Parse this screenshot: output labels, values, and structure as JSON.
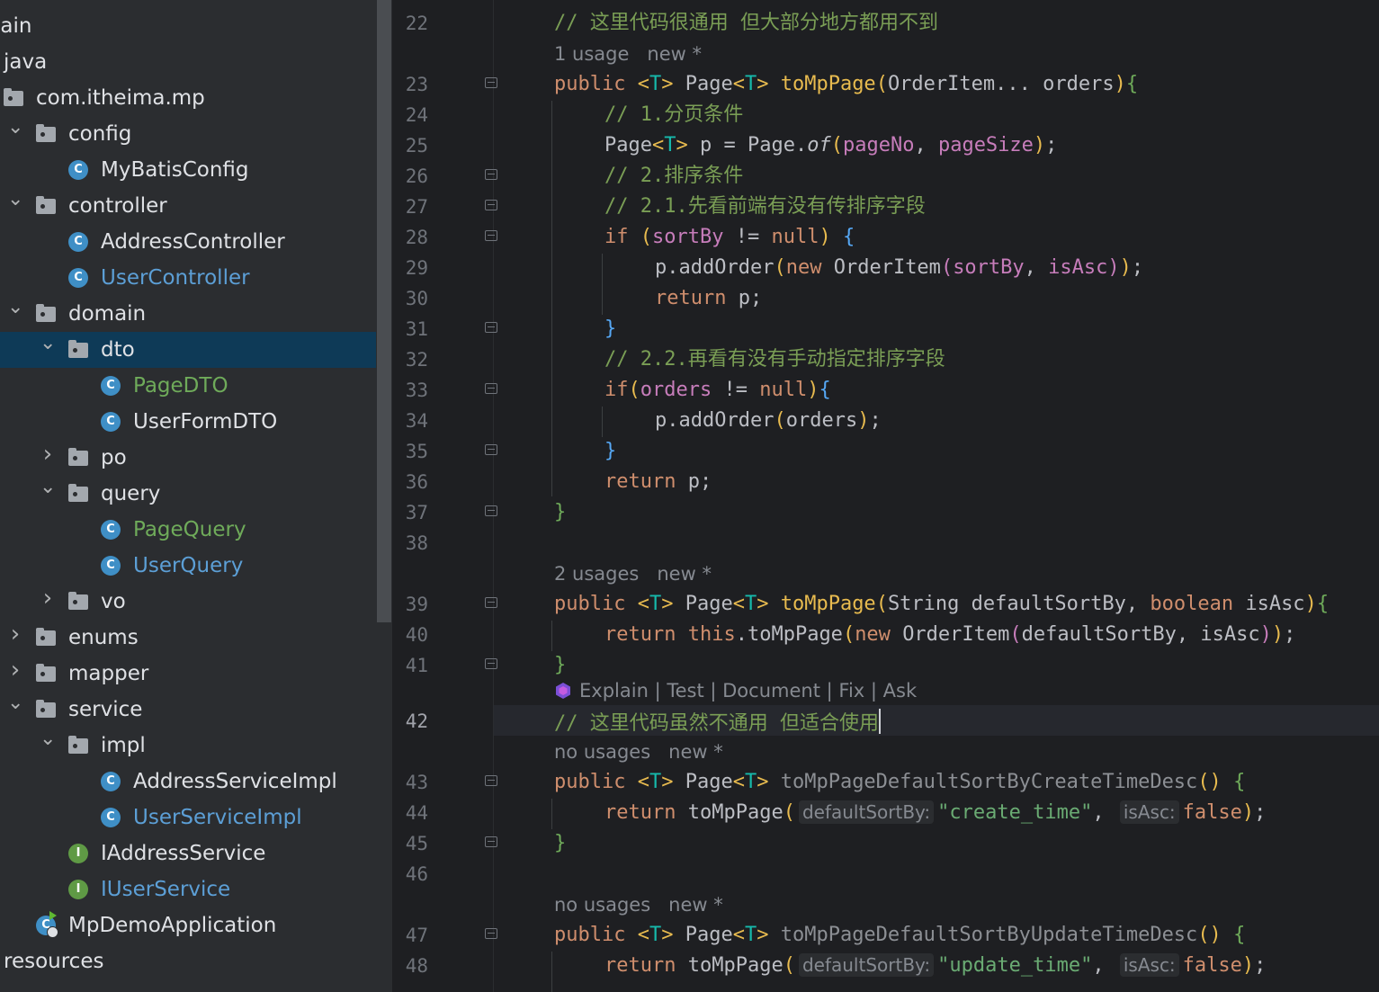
{
  "project_tree": {
    "items": [
      {
        "label": "main",
        "indent": 0,
        "chevron": "",
        "icon": "none",
        "state": "normal"
      },
      {
        "label": "java",
        "indent": 0,
        "chevron": "",
        "icon": "none",
        "state": "normal"
      },
      {
        "label": "com.itheima.mp",
        "indent": 0,
        "chevron": "",
        "icon": "package",
        "state": "normal"
      },
      {
        "label": "config",
        "indent": 1,
        "chevron": "expanded",
        "icon": "folder",
        "state": "normal"
      },
      {
        "label": "MyBatisConfig",
        "indent": 2,
        "chevron": "",
        "icon": "class",
        "state": "normal"
      },
      {
        "label": "controller",
        "indent": 1,
        "chevron": "expanded",
        "icon": "folder",
        "state": "normal"
      },
      {
        "label": "AddressController",
        "indent": 2,
        "chevron": "",
        "icon": "class",
        "state": "normal"
      },
      {
        "label": "UserController",
        "indent": 2,
        "chevron": "",
        "icon": "class",
        "state": "modified"
      },
      {
        "label": "domain",
        "indent": 1,
        "chevron": "expanded",
        "icon": "folder",
        "state": "normal"
      },
      {
        "label": "dto",
        "indent": 2,
        "chevron": "expanded",
        "icon": "folder",
        "state": "normal",
        "selected": true
      },
      {
        "label": "PageDTO",
        "indent": 3,
        "chevron": "",
        "icon": "class",
        "state": "added"
      },
      {
        "label": "UserFormDTO",
        "indent": 3,
        "chevron": "",
        "icon": "class",
        "state": "normal"
      },
      {
        "label": "po",
        "indent": 2,
        "chevron": "collapsed",
        "icon": "folder",
        "state": "normal"
      },
      {
        "label": "query",
        "indent": 2,
        "chevron": "expanded",
        "icon": "folder",
        "state": "normal"
      },
      {
        "label": "PageQuery",
        "indent": 3,
        "chevron": "",
        "icon": "class",
        "state": "added"
      },
      {
        "label": "UserQuery",
        "indent": 3,
        "chevron": "",
        "icon": "class",
        "state": "modified"
      },
      {
        "label": "vo",
        "indent": 2,
        "chevron": "collapsed",
        "icon": "folder",
        "state": "normal"
      },
      {
        "label": "enums",
        "indent": 1,
        "chevron": "collapsed",
        "icon": "folder",
        "state": "normal"
      },
      {
        "label": "mapper",
        "indent": 1,
        "chevron": "collapsed",
        "icon": "folder",
        "state": "normal"
      },
      {
        "label": "service",
        "indent": 1,
        "chevron": "expanded",
        "icon": "folder",
        "state": "normal"
      },
      {
        "label": "impl",
        "indent": 2,
        "chevron": "expanded",
        "icon": "folder",
        "state": "normal"
      },
      {
        "label": "AddressServiceImpl",
        "indent": 3,
        "chevron": "",
        "icon": "class",
        "state": "normal"
      },
      {
        "label": "UserServiceImpl",
        "indent": 3,
        "chevron": "",
        "icon": "class",
        "state": "modified"
      },
      {
        "label": "IAddressService",
        "indent": 2,
        "chevron": "",
        "icon": "interface",
        "state": "normal"
      },
      {
        "label": "IUserService",
        "indent": 2,
        "chevron": "",
        "icon": "interface",
        "state": "modified"
      },
      {
        "label": "MpDemoApplication",
        "indent": 1,
        "chevron": "",
        "icon": "app",
        "state": "normal"
      },
      {
        "label": "resources",
        "indent": 0,
        "chevron": "",
        "icon": "none",
        "state": "normal"
      }
    ]
  },
  "editor": {
    "current_line": "42",
    "inlay": {
      "defaultSortBy": "defaultSortBy:",
      "isAsc": "isAsc:"
    },
    "ai_actions": {
      "explain": "Explain",
      "test": "Test",
      "document": "Document",
      "fix": "Fix",
      "ask": "Ask",
      "sep": "|"
    },
    "lenses": {
      "l23": "1 usage   new *",
      "l39": "2 usages   new *",
      "l43": "no usages   new *",
      "l47": "no usages   new *"
    },
    "text": {
      "c22": "// 这里代码很通用 但大部分地方都用不到",
      "c24": "// 1.分页条件",
      "c26": "// 2.排序条件",
      "c27": "// 2.1.先看前端有没有传排序字段",
      "c32": "// 2.2.再看有没有手动指定排序字段",
      "c42": "// 这里代码虽然不通用 但适合使用",
      "public": "public",
      "T": "T",
      "Page": "Page",
      "toMpPage": "toMpPage",
      "OrderItem": "OrderItem",
      "orders": "orders",
      "p": "p",
      "of": "of",
      "pageNo": "pageNo",
      "pageSize": "pageSize",
      "if": "if",
      "sortBy": "sortBy",
      "null": "null",
      "addOrder": "addOrder",
      "new": "new",
      "isAsc": "isAsc",
      "return": "return",
      "String": "String",
      "defaultSortBy": "defaultSortBy",
      "boolean": "boolean",
      "this": "this",
      "false": "false",
      "ctDesc": "toMpPageDefaultSortByCreateTimeDesc",
      "utDesc": "toMpPageDefaultSortByUpdateTimeDesc",
      "create_time": "\"create_time\"",
      "update_time": "\"update_time\""
    }
  },
  "colors": {
    "background": "#1e1f22",
    "sidebar": "#2b2d30",
    "selection": "#0e3a57",
    "keyword": "#cf8e6d",
    "comment": "#7a9e55",
    "method": "#56a8f5",
    "string": "#6aab73",
    "type_param": "#16baac",
    "field": "#c77dbb"
  }
}
